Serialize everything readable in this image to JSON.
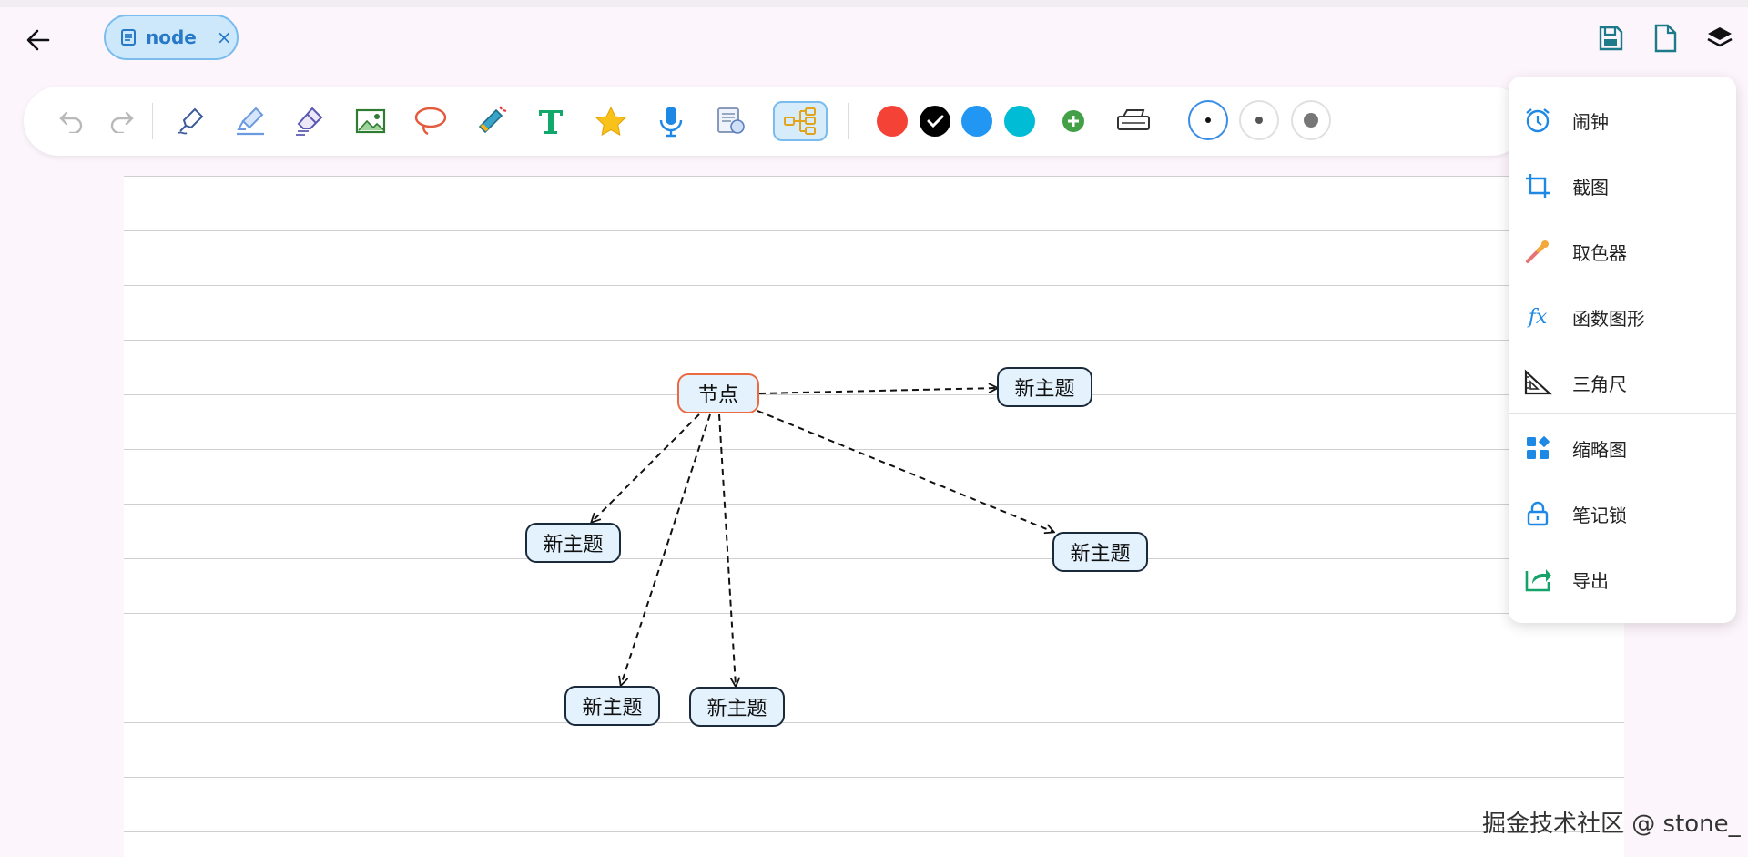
{
  "tab": {
    "label": "node",
    "close": "×"
  },
  "mindmap": {
    "root": "节点",
    "children": [
      "新主题",
      "新主题",
      "新主题",
      "新主题",
      "新主题"
    ]
  },
  "colors": {
    "accent": "#3a8ce6",
    "root_border": "#ec6a42",
    "swatches": [
      "#f44336",
      "#000000",
      "#2196f3",
      "#00bcd4"
    ]
  },
  "menu": {
    "items": [
      {
        "label": "闹钟",
        "icon": "alarm-clock-icon"
      },
      {
        "label": "截图",
        "icon": "crop-icon"
      },
      {
        "label": "取色器",
        "icon": "color-picker-icon"
      },
      {
        "label": "函数图形",
        "icon": "function-icon",
        "icon_text": "fx"
      },
      {
        "label": "三角尺",
        "icon": "triangle-ruler-icon"
      },
      {
        "label": "缩略图",
        "icon": "thumbnail-icon"
      },
      {
        "label": "笔记锁",
        "icon": "lock-icon"
      },
      {
        "label": "导出",
        "icon": "export-icon"
      }
    ]
  },
  "watermark": "掘金技术社区 @ stone_"
}
